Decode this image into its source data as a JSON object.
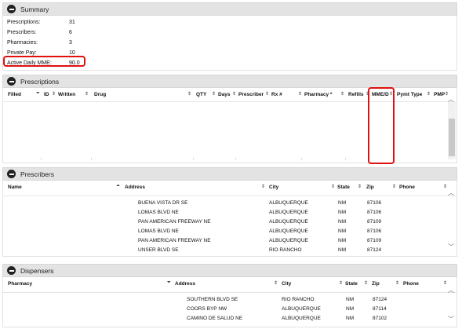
{
  "summary": {
    "title": "Summary",
    "rows": [
      {
        "label": "Prescriptions:",
        "value": "31"
      },
      {
        "label": "Prescribers:",
        "value": "6"
      },
      {
        "label": "Pharmacies:",
        "value": "3"
      },
      {
        "label": "Private Pay:",
        "value": "10"
      },
      {
        "label": "Active Daily MME:",
        "value": "90.0"
      }
    ]
  },
  "prescriptions": {
    "title": "Prescriptions",
    "columns": [
      "Filled",
      "ID",
      "Written",
      "Drug",
      "QTY",
      "Days",
      "Prescriber",
      "Rx #",
      "Pharmacy *",
      "Refills",
      "MME/D",
      "Pymt Type",
      "PMP"
    ]
  },
  "prescribers": {
    "title": "Prescribers",
    "columns": [
      "Name",
      "Address",
      "City",
      "State",
      "Zip",
      "Phone"
    ],
    "rows": [
      {
        "address": "BUENA VISTA DR SE",
        "city": "ALBUQUERQUE",
        "state": "NM",
        "zip": "87106"
      },
      {
        "address": "LOMAS BLVD NE",
        "city": "ALBUQUERQUE",
        "state": "NM",
        "zip": "87106"
      },
      {
        "address": "PAN AMERICAN FREEWAY NE",
        "city": "ALBUQUERQUE",
        "state": "NM",
        "zip": "87109"
      },
      {
        "address": "LOMAS BLVD NE",
        "city": "ALBUQUERQUE",
        "state": "NM",
        "zip": "87106"
      },
      {
        "address": "PAN AMERICAN FREEWAY NE",
        "city": "ALBUQUERQUE",
        "state": "NM",
        "zip": "87109"
      },
      {
        "address": "UNSER BLVD SE",
        "city": "RIO RANCHO",
        "state": "NM",
        "zip": "87124"
      }
    ]
  },
  "dispensers": {
    "title": "Dispensers",
    "columns": [
      "Pharmacy",
      "Address",
      "City",
      "State",
      "Zip",
      "Phone"
    ],
    "rows": [
      {
        "address": "SOUTHERN BLVD SE",
        "city": "RIO RANCHO",
        "state": "NM",
        "zip": "87124"
      },
      {
        "address": "COORS BYP NW",
        "city": "ALBUQUERQUE",
        "state": "NM",
        "zip": "87114"
      },
      {
        "address": "CAMINO DE SALUD NE",
        "city": "ALBUQUERQUE",
        "state": "NM",
        "zip": "87102"
      }
    ]
  },
  "colors": {
    "highlight": "#e01010",
    "header_bg": "#e3e3e3",
    "toggle": "#222222"
  },
  "icons": {
    "toggle": "collapse-minus-icon",
    "sort": "sort-arrows-icon",
    "scroll_up": "chevron-up-icon",
    "scroll_down": "chevron-down-icon"
  }
}
